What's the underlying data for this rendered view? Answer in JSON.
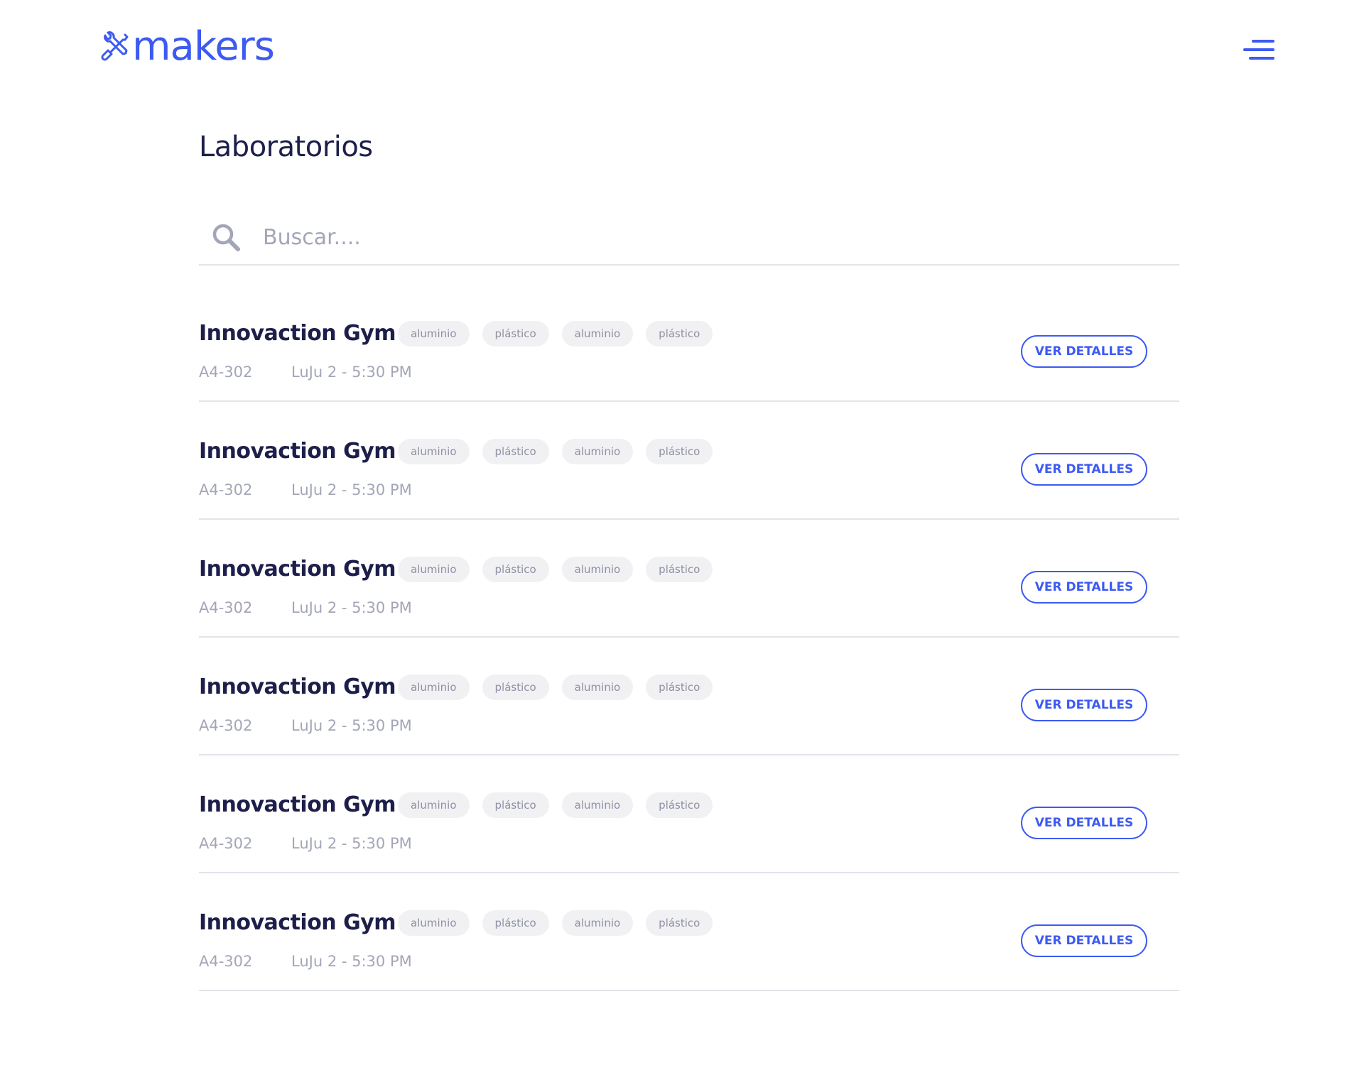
{
  "header": {
    "logo_text": "makers",
    "brand_color": "#3d5af1",
    "logo_icon": "tools-icon",
    "menu_icon": "hamburger-menu-icon"
  },
  "page": {
    "title": "Laboratorios"
  },
  "search": {
    "placeholder": "Buscar....",
    "value": "",
    "icon": "search-icon"
  },
  "labs": [
    {
      "name": "Innovaction Gym",
      "tags": [
        "aluminio",
        "plástico",
        "aluminio",
        "plástico"
      ],
      "room": "A4-302",
      "schedule": "LuJu 2 - 5:30 PM",
      "button_label": "VER DETALLES"
    },
    {
      "name": "Innovaction Gym",
      "tags": [
        "aluminio",
        "plástico",
        "aluminio",
        "plástico"
      ],
      "room": "A4-302",
      "schedule": "LuJu 2 - 5:30 PM",
      "button_label": "VER DETALLES"
    },
    {
      "name": "Innovaction Gym",
      "tags": [
        "aluminio",
        "plástico",
        "aluminio",
        "plástico"
      ],
      "room": "A4-302",
      "schedule": "LuJu 2 - 5:30 PM",
      "button_label": "VER DETALLES"
    },
    {
      "name": "Innovaction Gym",
      "tags": [
        "aluminio",
        "plástico",
        "aluminio",
        "plástico"
      ],
      "room": "A4-302",
      "schedule": "LuJu 2 - 5:30 PM",
      "button_label": "VER DETALLES"
    },
    {
      "name": "Innovaction Gym",
      "tags": [
        "aluminio",
        "plástico",
        "aluminio",
        "plástico"
      ],
      "room": "A4-302",
      "schedule": "LuJu 2 - 5:30 PM",
      "button_label": "VER DETALLES"
    },
    {
      "name": "Innovaction Gym",
      "tags": [
        "aluminio",
        "plástico",
        "aluminio",
        "plástico"
      ],
      "room": "A4-302",
      "schedule": "LuJu 2 - 5:30 PM",
      "button_label": "VER DETALLES"
    }
  ]
}
